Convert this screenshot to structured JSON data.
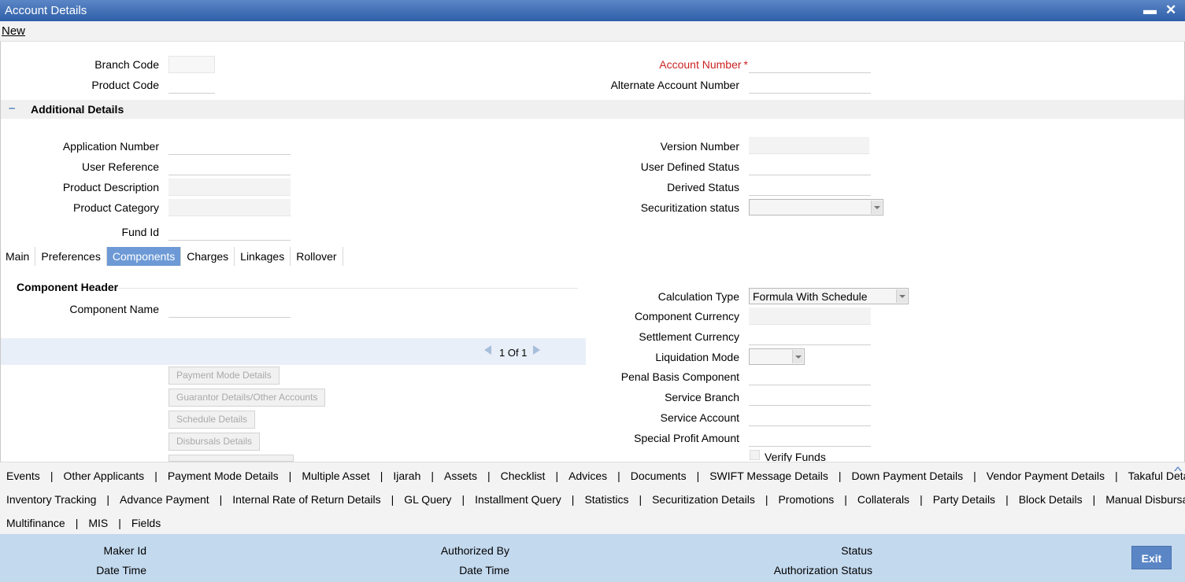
{
  "window": {
    "title": "Account Details"
  },
  "menu": {
    "new_label": "New"
  },
  "header_fields": {
    "branch_code": "Branch Code",
    "product_code": "Product Code",
    "account_number": "Account Number",
    "alternate_account_number": "Alternate Account Number"
  },
  "additional": {
    "title": "Additional Details",
    "application_number": "Application Number",
    "user_reference": "User Reference",
    "product_description": "Product Description",
    "product_category": "Product Category",
    "fund_id": "Fund Id",
    "version_number": "Version Number",
    "user_defined_status": "User Defined Status",
    "derived_status": "Derived Status",
    "securitization_status": "Securitization status"
  },
  "tabs": [
    "Main",
    "Preferences",
    "Components",
    "Charges",
    "Linkages",
    "Rollover"
  ],
  "components": {
    "header": "Component Header",
    "component_name": "Component Name",
    "pager_text": "1 Of 1",
    "calculation_type": "Calculation Type",
    "calculation_type_value": "Formula With Schedule",
    "component_currency": "Component Currency",
    "settlement_currency": "Settlement Currency",
    "liquidation_mode": "Liquidation Mode",
    "penal_basis_component": "Penal Basis Component",
    "service_branch": "Service Branch",
    "service_account": "Service Account",
    "special_profit_amount": "Special Profit Amount",
    "verify_funds": "Verify Funds",
    "buttons": [
      "Payment Mode Details",
      "Guarantor Details/Other Accounts",
      "Schedule Details",
      "Disbursals Details"
    ]
  },
  "footer_links": {
    "row1": [
      "Events",
      "Other Applicants",
      "Payment Mode Details",
      "Multiple Asset",
      "Ijarah",
      "Assets",
      "Checklist",
      "Advices",
      "Documents",
      "SWIFT Message Details",
      "Down Payment Details",
      "Vendor Payment Details",
      "Takaful Details"
    ],
    "row2": [
      "Inventory Tracking",
      "Advance Payment",
      "Internal Rate of Return Details",
      "GL Query",
      "Installment Query",
      "Statistics",
      "Securitization Details",
      "Promotions",
      "Collaterals",
      "Party Details",
      "Block Details",
      "Manual Disbursals"
    ],
    "row3": [
      "Multifinance",
      "MIS",
      "Fields"
    ]
  },
  "audit": {
    "maker_id": "Maker Id",
    "date_time_1": "Date Time",
    "authorized_by": "Authorized By",
    "date_time_2": "Date Time",
    "status": "Status",
    "authorization_status": "Authorization Status",
    "exit_label": "Exit"
  }
}
